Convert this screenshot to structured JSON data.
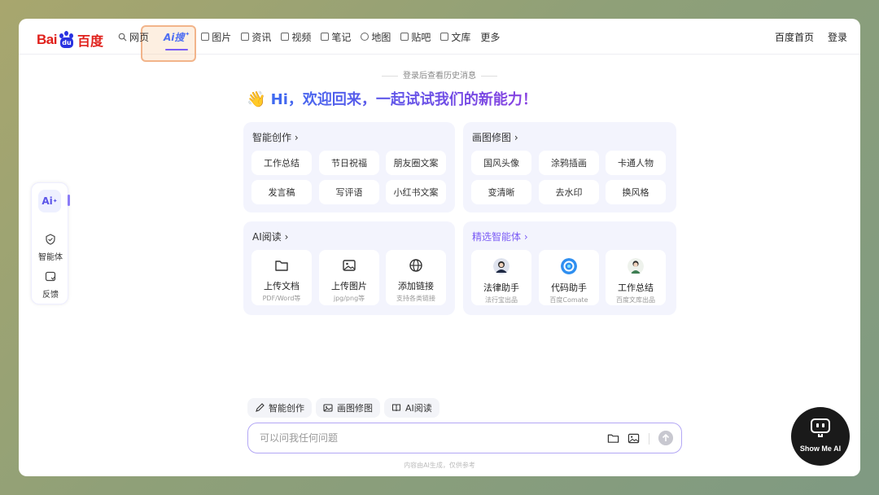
{
  "brand": {
    "logo_latin": "Bai",
    "logo_du": "du",
    "logo_cn": "百度"
  },
  "nav": {
    "items": [
      {
        "label": "网页",
        "icon": "search-icon"
      },
      {
        "label": "Ai搜",
        "icon": "ai-search-icon",
        "active": true
      },
      {
        "label": "图片",
        "icon": "image-icon"
      },
      {
        "label": "资讯",
        "icon": "news-icon"
      },
      {
        "label": "视频",
        "icon": "video-icon"
      },
      {
        "label": "笔记",
        "icon": "note-icon"
      },
      {
        "label": "地图",
        "icon": "map-icon"
      },
      {
        "label": "贴吧",
        "icon": "tieba-icon"
      },
      {
        "label": "文库",
        "icon": "library-icon"
      },
      {
        "label": "更多"
      }
    ],
    "right": {
      "home": "百度首页",
      "login": "登录"
    }
  },
  "history_tip": "登录后查看历史消息",
  "welcome": {
    "emoji": "👋",
    "text": "Hi，欢迎回来，一起试试我们的新能力！"
  },
  "cards": {
    "creation": {
      "title": "智能创作 ›",
      "chips": [
        "工作总结",
        "节日祝福",
        "朋友圈文案",
        "发言稿",
        "写评语",
        "小红书文案"
      ]
    },
    "image_edit": {
      "title": "画图修图 ›",
      "chips": [
        "国风头像",
        "涂鸦插画",
        "卡通人物",
        "变清晰",
        "去水印",
        "换风格"
      ]
    },
    "reading": {
      "title": "AI阅读 ›",
      "tiles": [
        {
          "label": "上传文档",
          "sub": "PDF/Word等",
          "icon": "folder-icon"
        },
        {
          "label": "上传图片",
          "sub": "jpg/png等",
          "icon": "image-icon"
        },
        {
          "label": "添加链接",
          "sub": "支持各类链接",
          "icon": "globe-icon"
        }
      ]
    },
    "agents": {
      "title": "精选智能体 ›",
      "tiles": [
        {
          "label": "法律助手",
          "sub": "法行宝出品",
          "icon": "lawyer-avatar"
        },
        {
          "label": "代码助手",
          "sub": "百度Comate",
          "icon": "code-assistant-logo"
        },
        {
          "label": "工作总结",
          "sub": "百度文库出品",
          "icon": "worker-avatar"
        }
      ]
    }
  },
  "sidebar": {
    "ai_label": "Ai",
    "items": [
      {
        "label": "智能体",
        "icon": "agent-icon"
      },
      {
        "label": "反馈",
        "icon": "feedback-icon"
      }
    ]
  },
  "quick_actions": [
    {
      "label": "智能创作",
      "icon": "pen-icon"
    },
    {
      "label": "画图修图",
      "icon": "image-icon"
    },
    {
      "label": "AI阅读",
      "icon": "book-icon"
    }
  ],
  "input": {
    "placeholder": "可以问我任何问题"
  },
  "disclaimer": "内容由AI生成，仅供参考",
  "watermark": {
    "label": "Show Me AI"
  },
  "colors": {
    "accent": "#4e6ef2",
    "purple": "#7b5cf5",
    "brand_red": "#e0201b",
    "brand_blue": "#2932e1"
  }
}
